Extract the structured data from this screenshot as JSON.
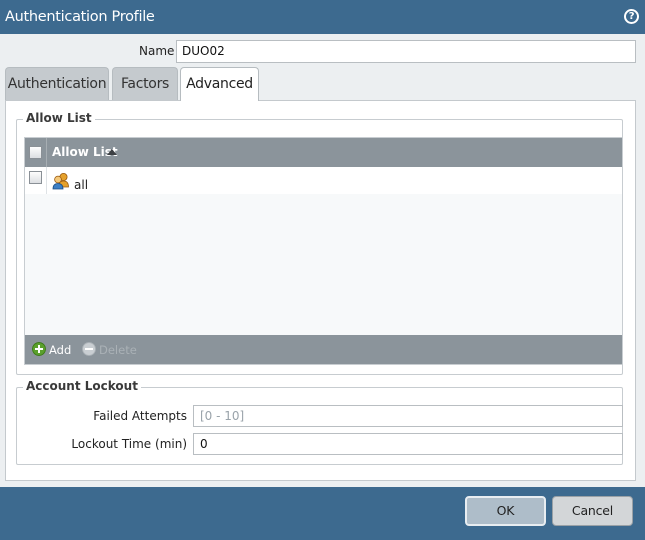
{
  "window": {
    "title": "Authentication Profile",
    "help_symbol": "?"
  },
  "form": {
    "name_label": "Name",
    "name_value": "DUO02"
  },
  "tabs": [
    {
      "label": "Authentication",
      "active": false
    },
    {
      "label": "Factors",
      "active": false
    },
    {
      "label": "Advanced",
      "active": true
    }
  ],
  "allow_list": {
    "legend": "Allow List",
    "column_header": "Allow List",
    "sort": "ascending",
    "rows": [
      {
        "value": "all",
        "icon": "user-group-icon"
      }
    ],
    "toolbar": {
      "add_label": "Add",
      "delete_label": "Delete",
      "delete_enabled": false
    }
  },
  "account_lockout": {
    "legend": "Account Lockout",
    "failed_attempts_label": "Failed Attempts",
    "failed_attempts_placeholder": "[0 - 10]",
    "failed_attempts_value": "",
    "lockout_time_label": "Lockout Time (min)",
    "lockout_time_value": "0"
  },
  "buttons": {
    "ok_label": "OK",
    "cancel_label": "Cancel"
  },
  "colors": {
    "title_bar": "#3d6a8f",
    "grid_header": "#8b949b",
    "add_icon": "#5aa02c",
    "delete_icon_disabled": "#c9ced2"
  }
}
